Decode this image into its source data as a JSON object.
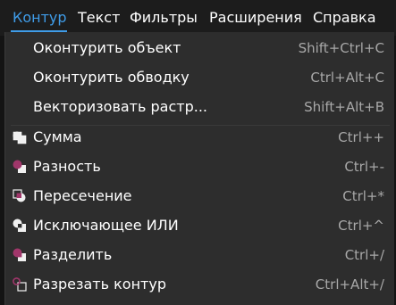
{
  "menubar": {
    "items": [
      {
        "label": "Контур",
        "active": true
      },
      {
        "label": "Текст",
        "active": false
      },
      {
        "label": "Фильтры",
        "active": false
      },
      {
        "label": "Расширения",
        "active": false
      },
      {
        "label": "Справка",
        "active": false
      }
    ]
  },
  "path_menu": {
    "items": [
      {
        "label": "Оконтурить объект",
        "shortcut": "Shift+Ctrl+C",
        "icon": null
      },
      {
        "label": "Оконтурить обводку",
        "shortcut": "Ctrl+Alt+C",
        "icon": null
      },
      {
        "label": "Векторизовать растр...",
        "shortcut": "Shift+Alt+B",
        "icon": null
      },
      {
        "label": "Сумма",
        "shortcut": "Ctrl++",
        "icon": "path-union-icon"
      },
      {
        "label": "Разность",
        "shortcut": "Ctrl+-",
        "icon": "path-difference-icon"
      },
      {
        "label": "Пересечение",
        "shortcut": "Ctrl+*",
        "icon": "path-intersection-icon"
      },
      {
        "label": "Исключающее ИЛИ",
        "shortcut": "Ctrl+^",
        "icon": "path-exclusion-icon"
      },
      {
        "label": "Разделить",
        "shortcut": "Ctrl+/",
        "icon": "path-division-icon"
      },
      {
        "label": "Разрезать контур",
        "shortcut": "Ctrl+Alt+/",
        "icon": "path-cut-icon"
      }
    ]
  },
  "colors": {
    "accent": "#3f9ce8",
    "menu_background": "#2d2d2d",
    "icon_magenta": "#a0366a",
    "icon_white": "#f0f0f0"
  }
}
